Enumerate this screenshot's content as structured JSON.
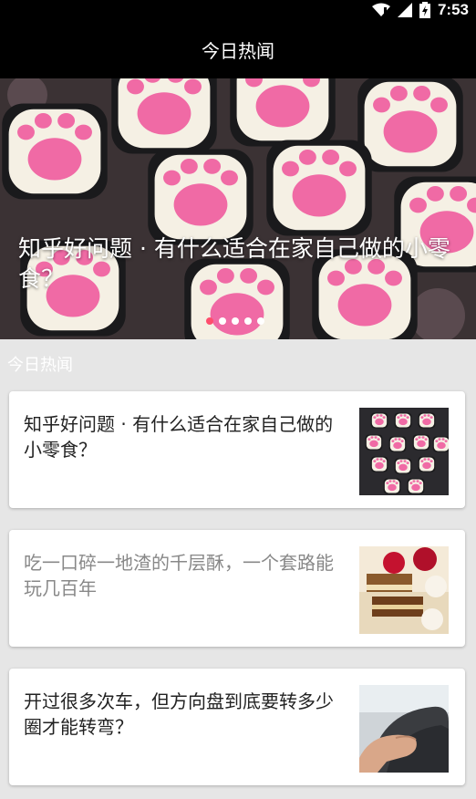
{
  "status_bar": {
    "time": "7:53"
  },
  "app_bar": {
    "title": "今日热闻"
  },
  "banner": {
    "title": "知乎好问题 · 有什么适合在家自己做的小零食？",
    "slides": 5,
    "active_slide": 1
  },
  "section": {
    "title": "今日热闻"
  },
  "stories": [
    {
      "title": "知乎好问题 · 有什么适合在家自己做的小零食？",
      "read": false,
      "thumb": "cat-paw-sweets"
    },
    {
      "title": "吃一口碎一地渣的千层酥，一个套路能玩几百年",
      "read": true,
      "thumb": "pastry-cakes"
    },
    {
      "title": "开过很多次车，但方向盘到底要转多少圈才能转弯？",
      "read": false,
      "thumb": "steering-wheel"
    }
  ],
  "colors": {
    "app_bar": "#000000",
    "background": "#e6e6e6",
    "dot_active": "#ff4d6d",
    "paw_pink": "#f06aa5"
  }
}
